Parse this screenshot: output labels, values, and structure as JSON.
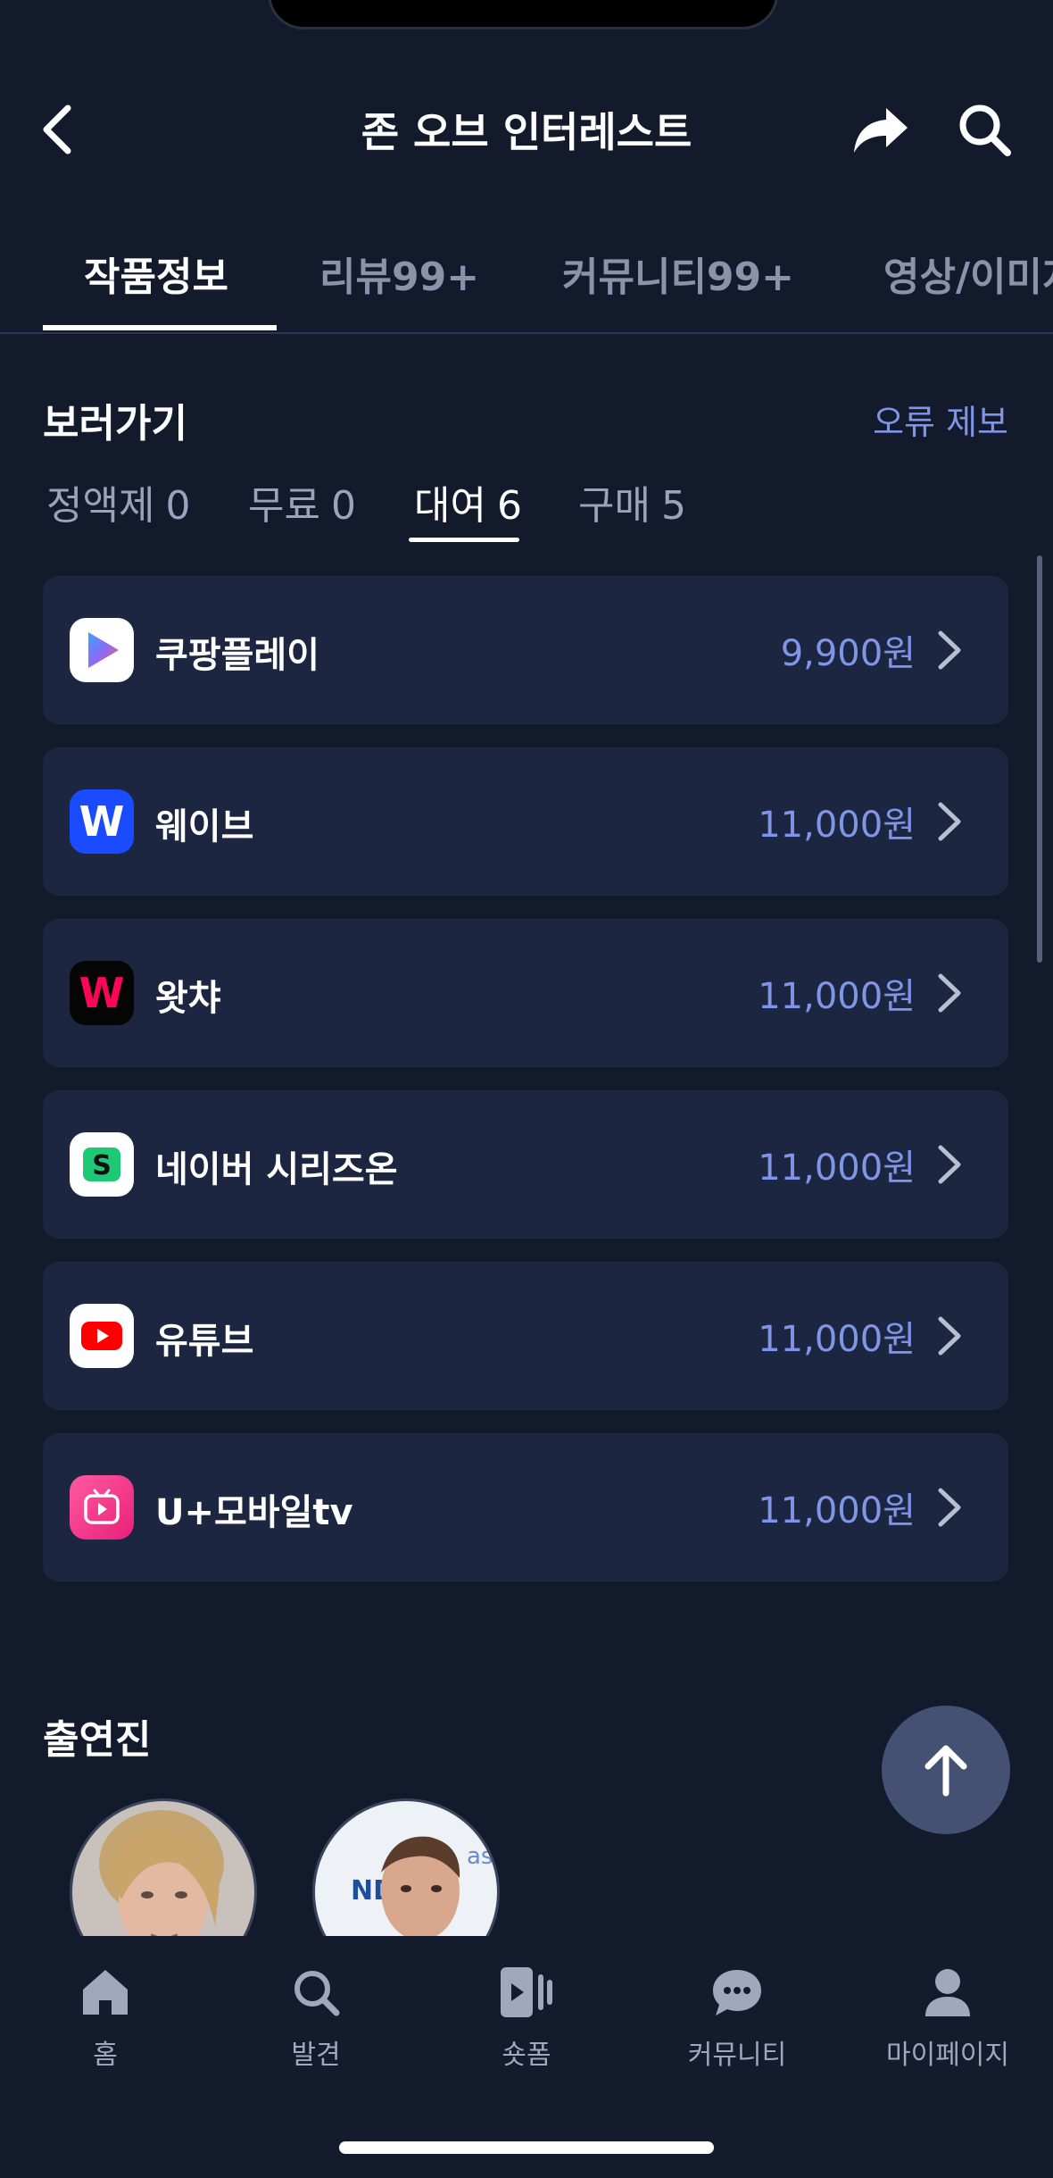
{
  "header": {
    "title": "존 오브 인터레스트"
  },
  "tabs": [
    {
      "label": "작품정보",
      "active": true
    },
    {
      "label": "리뷰99+",
      "active": false
    },
    {
      "label": "커뮤니티99+",
      "active": false
    },
    {
      "label": "영상/이미지",
      "active": false
    }
  ],
  "watch": {
    "title": "보러가기",
    "report": "오류 제보",
    "subtabs": [
      {
        "label": "정액제",
        "count": "0",
        "active": false
      },
      {
        "label": "무료",
        "count": "0",
        "active": false
      },
      {
        "label": "대여",
        "count": "6",
        "active": true
      },
      {
        "label": "구매",
        "count": "5",
        "active": false
      }
    ],
    "providers": [
      {
        "name": "쿠팡플레이",
        "price": "9,900원",
        "icon": "coupang-play-icon"
      },
      {
        "name": "웨이브",
        "price": "11,000원",
        "icon": "wavve-icon"
      },
      {
        "name": "왓챠",
        "price": "11,000원",
        "icon": "watcha-icon"
      },
      {
        "name": "네이버 시리즈온",
        "price": "11,000원",
        "icon": "naver-serieson-icon"
      },
      {
        "name": "유튜브",
        "price": "11,000원",
        "icon": "youtube-icon"
      },
      {
        "name": "U+모바일tv",
        "price": "11,000원",
        "icon": "uplus-mobile-tv-icon"
      }
    ]
  },
  "cast": {
    "title": "출연진"
  },
  "nav": [
    {
      "label": "홈",
      "icon": "home-icon"
    },
    {
      "label": "발견",
      "icon": "search-icon"
    },
    {
      "label": "숏폼",
      "icon": "shortform-icon"
    },
    {
      "label": "커뮤니티",
      "icon": "chat-bubble-icon"
    },
    {
      "label": "마이페이지",
      "icon": "person-icon"
    }
  ],
  "colors": {
    "background": "#121a2c",
    "card": "#1c2641",
    "accent": "#7f96e8",
    "fab": "#445172"
  }
}
